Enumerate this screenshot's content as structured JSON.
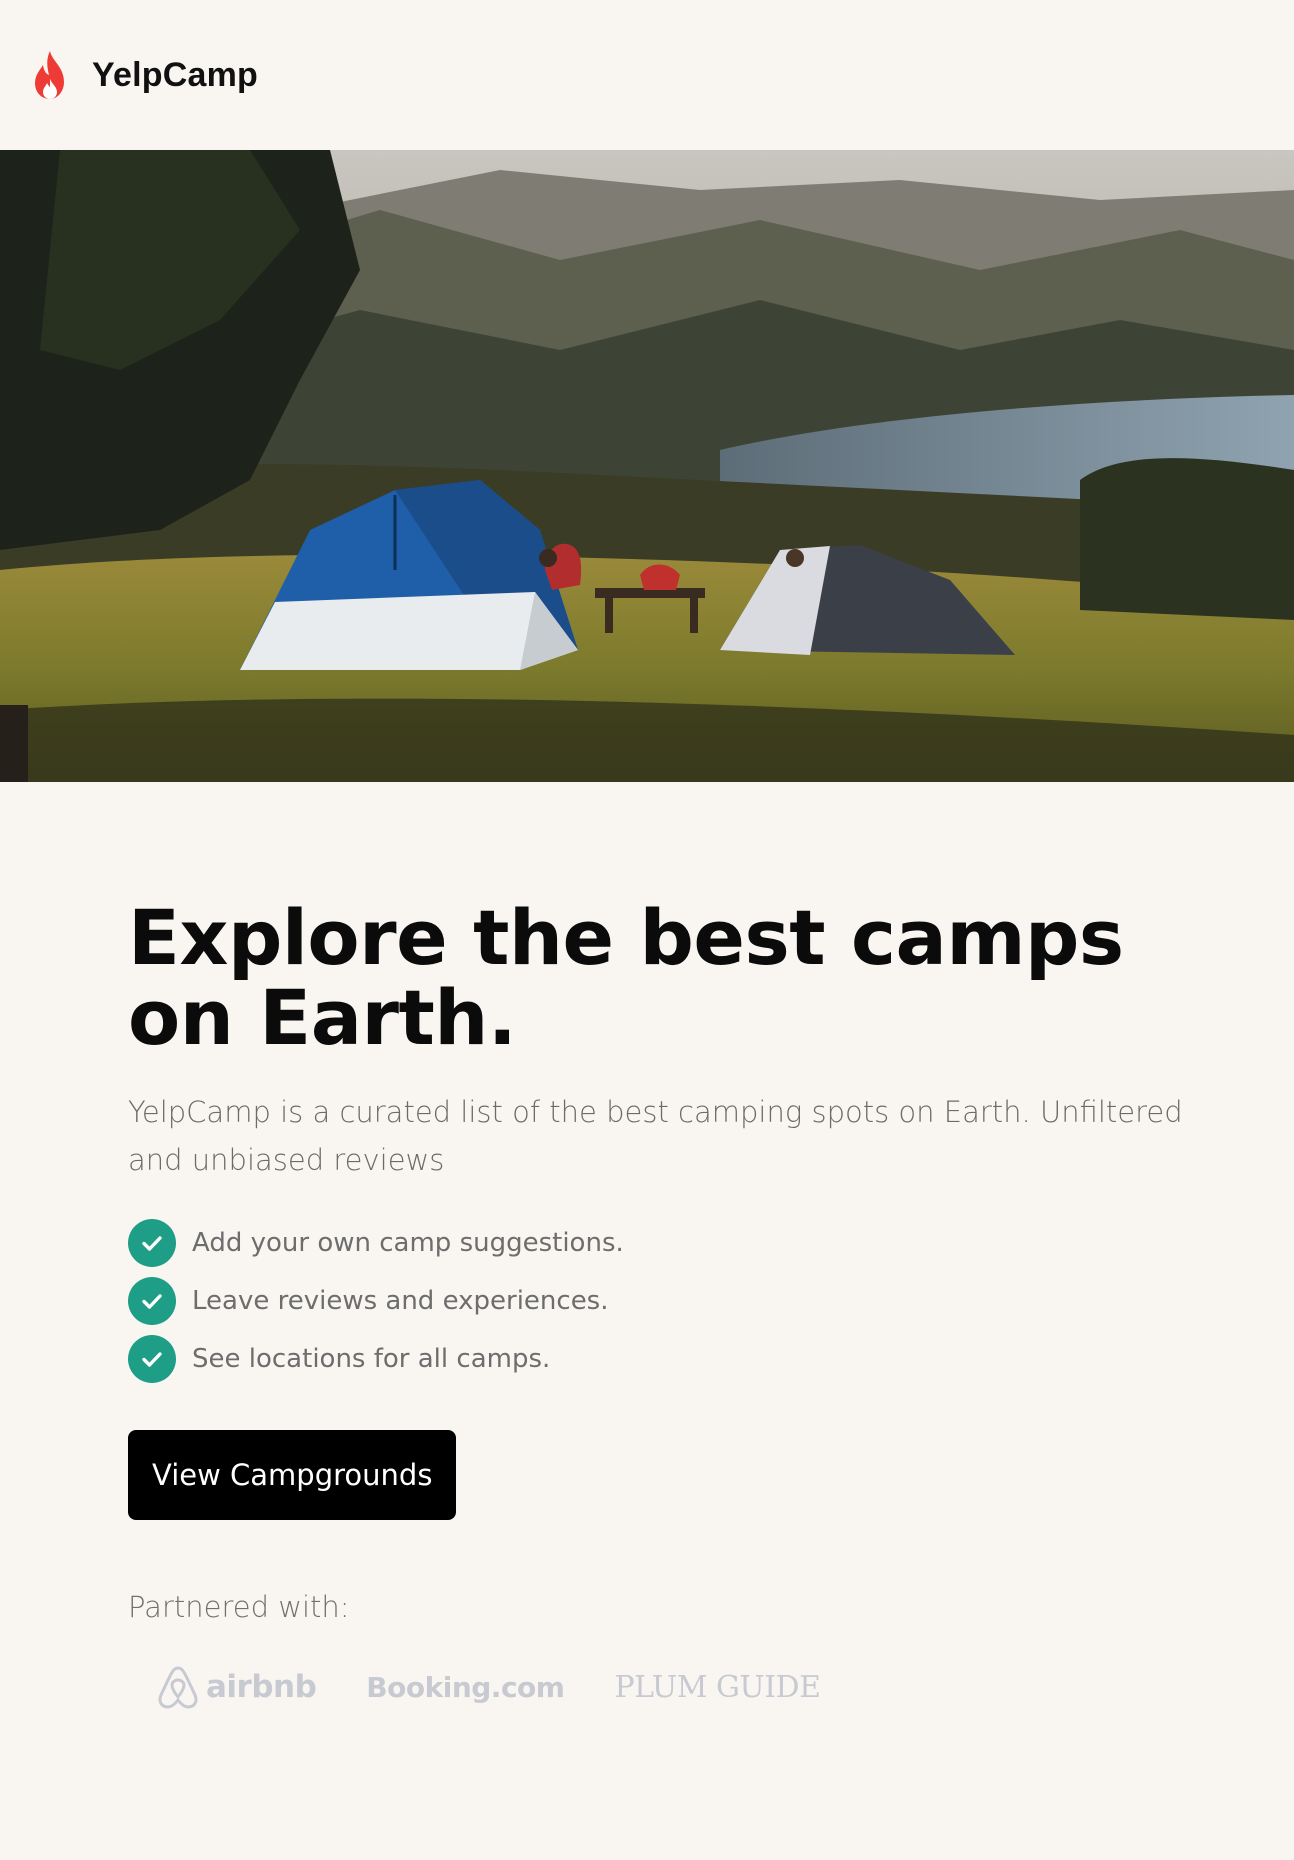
{
  "brand": {
    "name": "YelpCamp",
    "icon": "flame-icon",
    "icon_color": "#ef3b36"
  },
  "hero": {
    "image": "camping-tents-on-hilltop-overlooking-lake"
  },
  "headline": "Explore the best camps on Earth.",
  "lead": "YelpCamp is a curated list of the best camping spots on Earth. Unfiltered and unbiased reviews",
  "features": [
    {
      "text": "Add your own camp suggestions.",
      "icon": "check-circle-icon"
    },
    {
      "text": "Leave reviews and experiences.",
      "icon": "check-circle-icon"
    },
    {
      "text": "See locations for all camps.",
      "icon": "check-circle-icon"
    }
  ],
  "cta": {
    "label": "View Campgrounds"
  },
  "partners": {
    "label": "Partnered with:",
    "items": [
      "airbnb",
      "Booking.com",
      "PLUM GUIDE"
    ]
  },
  "colors": {
    "background": "#f9f6f2",
    "accent": "#1e9e86",
    "button": "#000000",
    "partner_logo": "#c8cad2"
  }
}
